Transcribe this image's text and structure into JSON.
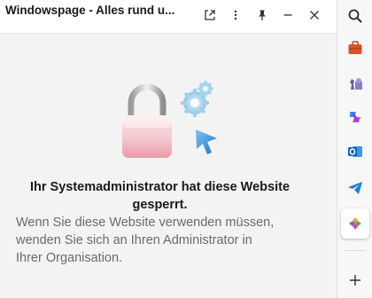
{
  "pane": {
    "title": "Windowspage - Alles rund u...",
    "buttons": [
      "open-in-new-tab",
      "more-options",
      "pin",
      "minimize",
      "close"
    ]
  },
  "message": {
    "title_line1": "Ihr Systemadministrator hat diese Website",
    "title_line2": "gesperrt.",
    "desc_line1": "Wenn Sie diese Website verwenden müssen,",
    "desc_line2": "wenden Sie sich an Ihren Administrator in",
    "desc_line3": "Ihrer Organisation."
  },
  "sidebar": {
    "items": [
      {
        "name": "search-icon",
        "color": "#2b2b2b"
      },
      {
        "name": "toolbox-icon",
        "color": "#d4532b"
      },
      {
        "name": "games-icon",
        "color": "#6b5ea6"
      },
      {
        "name": "copilot-icon",
        "color": "#6c4bd8"
      },
      {
        "name": "outlook-icon",
        "color": "#0a64c8"
      },
      {
        "name": "telegram-icon",
        "color": "#1f7fd8"
      },
      {
        "name": "app-icon",
        "color": "#e8a030"
      }
    ],
    "add_label": "+"
  }
}
